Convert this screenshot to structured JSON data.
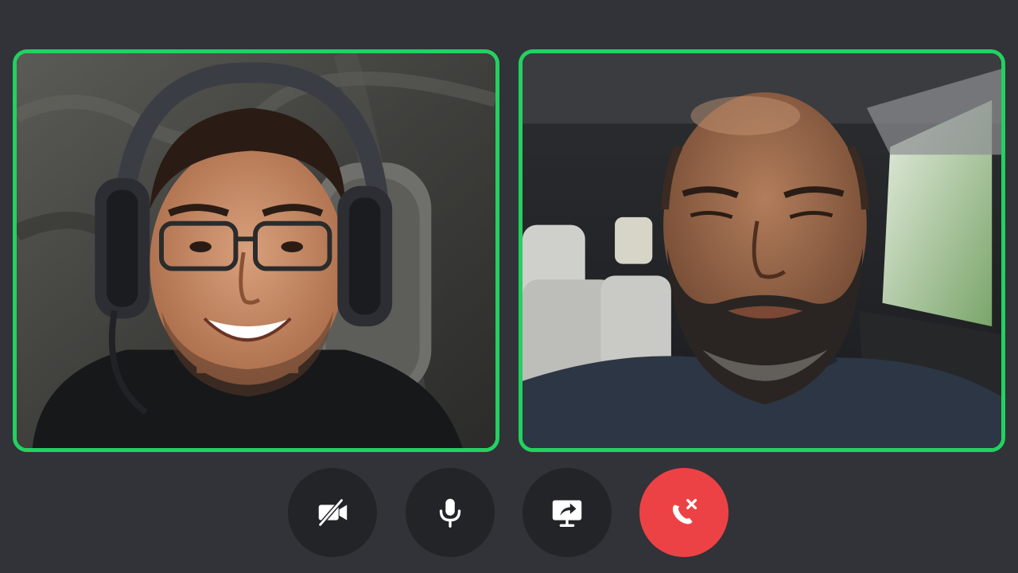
{
  "call": {
    "participants": [
      {
        "id": "left",
        "speaking": true
      },
      {
        "id": "right",
        "speaking": true
      }
    ],
    "speaking_color": "#23d160"
  },
  "controls": [
    {
      "id": "camera",
      "icon": "video-off-icon",
      "state": "off"
    },
    {
      "id": "mic",
      "icon": "microphone-icon",
      "state": "on"
    },
    {
      "id": "share",
      "icon": "screen-share-icon",
      "state": "idle"
    },
    {
      "id": "end",
      "icon": "end-call-icon",
      "color": "#ed4245"
    }
  ],
  "colors": {
    "background": "#313338",
    "control_bg": "#232428",
    "end_call": "#ed4245",
    "icon": "#ffffff"
  }
}
